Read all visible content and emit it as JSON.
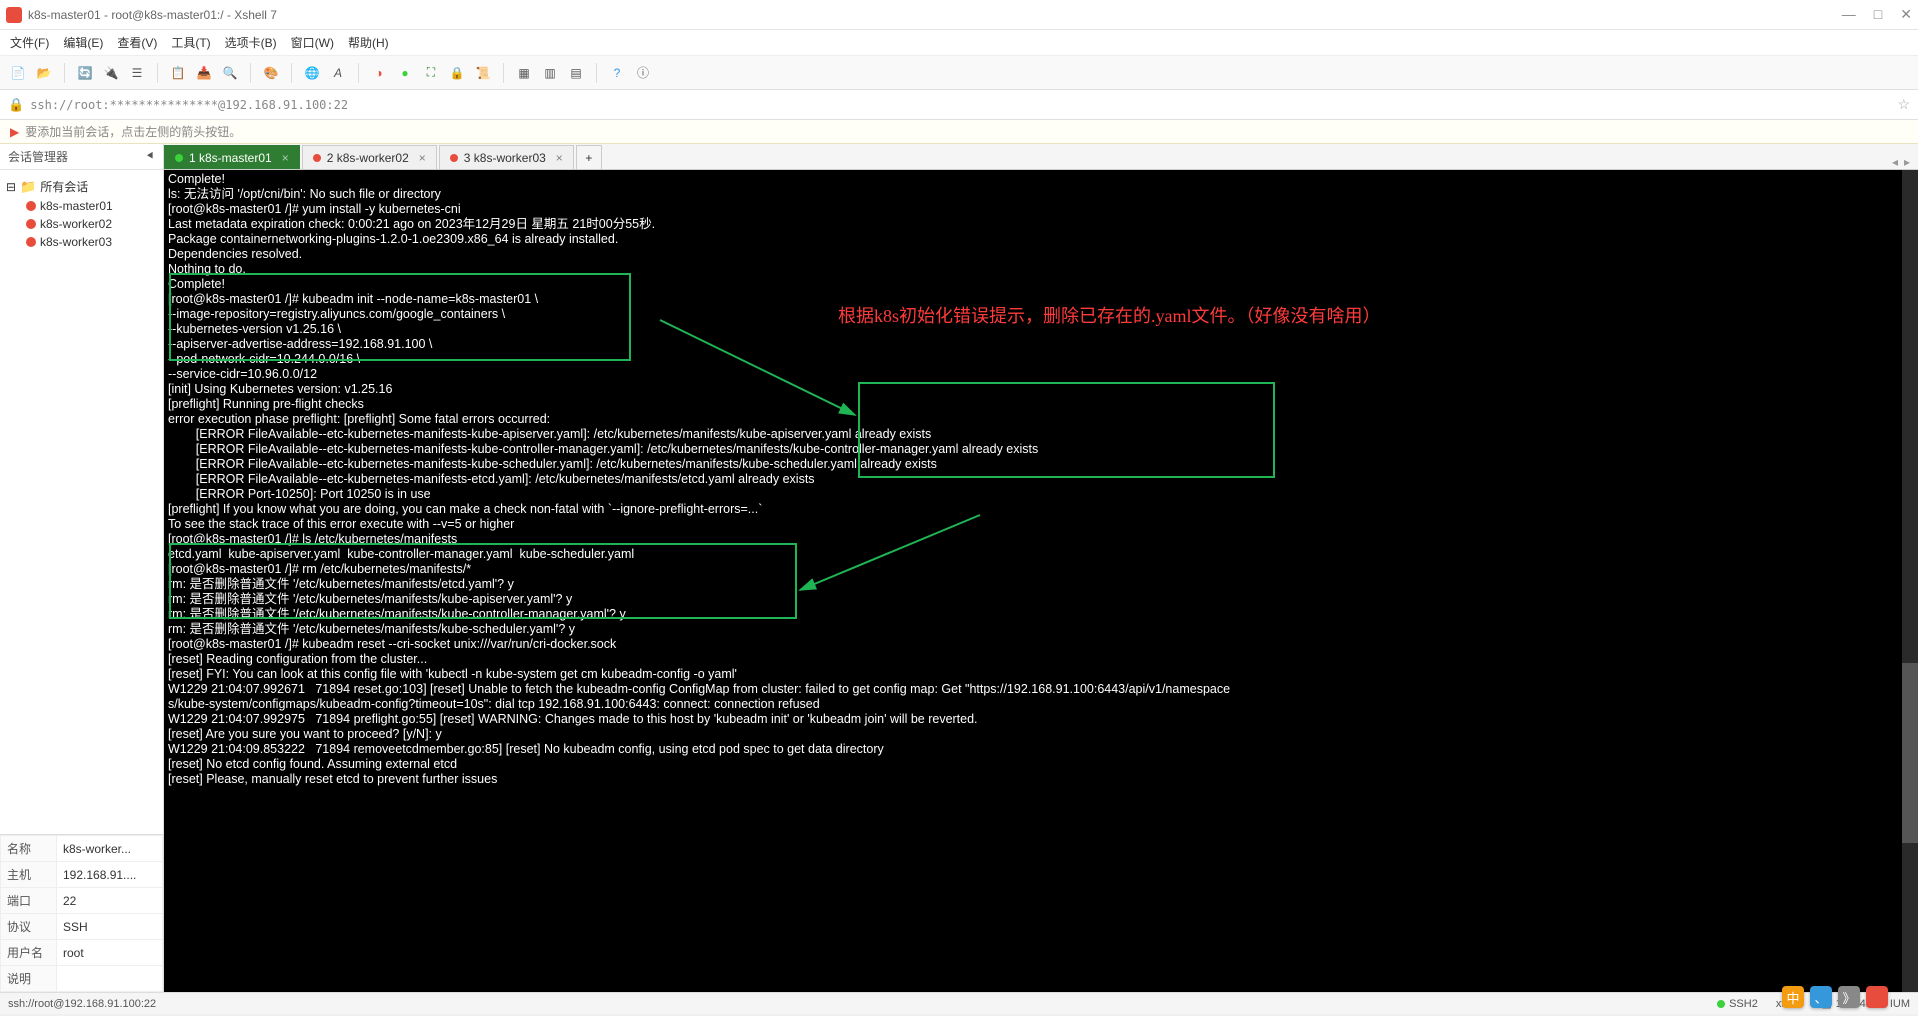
{
  "window": {
    "title": "k8s-master01 - root@k8s-master01:/ - Xshell 7",
    "min": "—",
    "max": "□",
    "close": "✕"
  },
  "menu": [
    "文件(F)",
    "编辑(E)",
    "查看(V)",
    "工具(T)",
    "选项卡(B)",
    "窗口(W)",
    "帮助(H)"
  ],
  "addr": {
    "text": "ssh://root:***************@192.168.91.100:22"
  },
  "hint": "要添加当前会话，点击左侧的箭头按钮。",
  "session_mgr_title": "会话管理器",
  "tree": {
    "root": "所有会话",
    "items": [
      "k8s-master01",
      "k8s-worker02",
      "k8s-worker03"
    ]
  },
  "props": {
    "rows": [
      [
        "名称",
        "k8s-worker..."
      ],
      [
        "主机",
        "192.168.91...."
      ],
      [
        "端口",
        "22"
      ],
      [
        "协议",
        "SSH"
      ],
      [
        "用户名",
        "root"
      ],
      [
        "说明",
        ""
      ]
    ]
  },
  "tabs": [
    {
      "label": "1 k8s-master01",
      "active": true,
      "dot": "green"
    },
    {
      "label": "2 k8s-worker02",
      "active": false,
      "dot": "red"
    },
    {
      "label": "3 k8s-worker03",
      "active": false,
      "dot": "red"
    }
  ],
  "terminal_lines": [
    "Complete!",
    "ls: 无法访问 '/opt/cni/bin': No such file or directory",
    "[root@k8s-master01 /]# yum install -y kubernetes-cni",
    "Last metadata expiration check: 0:00:21 ago on 2023年12月29日 星期五 21时00分55秒.",
    "Package containernetworking-plugins-1.2.0-1.oe2309.x86_64 is already installed.",
    "Dependencies resolved.",
    "Nothing to do.",
    "Complete!",
    "[root@k8s-master01 /]# kubeadm init --node-name=k8s-master01 \\",
    "--image-repository=registry.aliyuncs.com/google_containers \\",
    "--kubernetes-version v1.25.16 \\",
    "--apiserver-advertise-address=192.168.91.100 \\",
    "--pod-network-cidr=10.244.0.0/16 \\",
    "--service-cidr=10.96.0.0/12",
    "[init] Using Kubernetes version: v1.25.16",
    "[preflight] Running pre-flight checks",
    "error execution phase preflight: [preflight] Some fatal errors occurred:",
    "        [ERROR FileAvailable--etc-kubernetes-manifests-kube-apiserver.yaml]: /etc/kubernetes/manifests/kube-apiserver.yaml already exists",
    "        [ERROR FileAvailable--etc-kubernetes-manifests-kube-controller-manager.yaml]: /etc/kubernetes/manifests/kube-controller-manager.yaml already exists",
    "        [ERROR FileAvailable--etc-kubernetes-manifests-kube-scheduler.yaml]: /etc/kubernetes/manifests/kube-scheduler.yaml already exists",
    "        [ERROR FileAvailable--etc-kubernetes-manifests-etcd.yaml]: /etc/kubernetes/manifests/etcd.yaml already exists",
    "        [ERROR Port-10250]: Port 10250 is in use",
    "[preflight] If you know what you are doing, you can make a check non-fatal with `--ignore-preflight-errors=...`",
    "To see the stack trace of this error execute with --v=5 or higher",
    "[root@k8s-master01 /]# ls /etc/kubernetes/manifests",
    "etcd.yaml  kube-apiserver.yaml  kube-controller-manager.yaml  kube-scheduler.yaml",
    "[root@k8s-master01 /]# rm /etc/kubernetes/manifests/*",
    "rm: 是否删除普通文件 '/etc/kubernetes/manifests/etcd.yaml'? y",
    "rm: 是否删除普通文件 '/etc/kubernetes/manifests/kube-apiserver.yaml'? y",
    "rm: 是否删除普通文件 '/etc/kubernetes/manifests/kube-controller-manager.yaml'? y",
    "rm: 是否删除普通文件 '/etc/kubernetes/manifests/kube-scheduler.yaml'? y",
    "[root@k8s-master01 /]# kubeadm reset --cri-socket unix:///var/run/cri-docker.sock",
    "[reset] Reading configuration from the cluster...",
    "[reset] FYI: You can look at this config file with 'kubectl -n kube-system get cm kubeadm-config -o yaml'",
    "W1229 21:04:07.992671   71894 reset.go:103] [reset] Unable to fetch the kubeadm-config ConfigMap from cluster: failed to get config map: Get \"https://192.168.91.100:6443/api/v1/namespace",
    "s/kube-system/configmaps/kubeadm-config?timeout=10s\": dial tcp 192.168.91.100:6443: connect: connection refused",
    "W1229 21:04:07.992975   71894 preflight.go:55] [reset] WARNING: Changes made to this host by 'kubeadm init' or 'kubeadm join' will be reverted.",
    "[reset] Are you sure you want to proceed? [y/N]: y",
    "W1229 21:04:09.853222   71894 removeetcdmember.go:85] [reset] No kubeadm config, using etcd pod spec to get data directory",
    "[reset] No etcd config found. Assuming external etcd",
    "[reset] Please, manually reset etcd to prevent further issues"
  ],
  "annotation": "根据k8s初始化错误提示，删除已存在的.yaml文件。（好像没有啥用）",
  "status": {
    "left": "ssh://root@192.168.91.100:22",
    "ssh": "SSH2",
    "term": "xterm",
    "size": "186x41",
    "caps": "IUM"
  },
  "bubbles": [
    "中",
    "、",
    "》",
    ""
  ]
}
